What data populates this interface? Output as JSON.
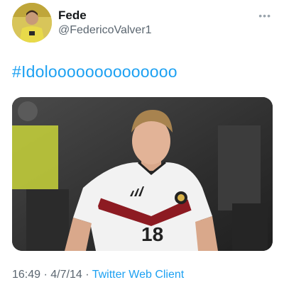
{
  "tweet": {
    "author_name": "Fede",
    "author_handle": "@FedericoValver1",
    "text": "#Idoloooooooooooooo",
    "time": "16:49",
    "separator": "·",
    "date": "4/7/14",
    "client": "Twitter Web Client",
    "more_label": "•••",
    "media": {
      "jersey_number": "18",
      "jersey_brand": "adidas"
    }
  },
  "colors": {
    "link": "#1da1f2",
    "secondary_text": "#5b6670",
    "primary_text": "#14171a"
  }
}
